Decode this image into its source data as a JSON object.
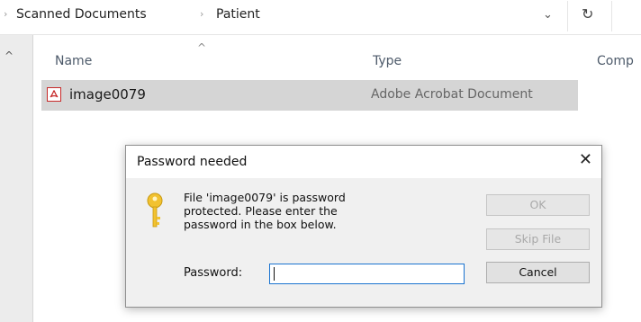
{
  "addressbar": {
    "breadcrumbs": [
      "Scanned Documents",
      "Patient"
    ],
    "separator": "›",
    "dropdown_icon": "chevron-down-icon",
    "refresh_icon": "refresh-icon"
  },
  "columns": {
    "name": "Name",
    "type": "Type",
    "compressed": "Comp"
  },
  "file_row": {
    "icon": "pdf-icon",
    "name": "image0079",
    "type": "Adobe Acrobat Document"
  },
  "dialog": {
    "title": "Password needed",
    "close_glyph": "✕",
    "message": "File 'image0079' is password protected. Please enter the password in the box below.",
    "ok_label": "OK",
    "skip_label": "Skip File",
    "cancel_label": "Cancel",
    "password_label": "Password:",
    "password_value": ""
  },
  "colors": {
    "selection": "#d5d5d5",
    "dialog_bg": "#f0f0f0",
    "input_focus_border": "#1a73d0",
    "key_icon": "#f2c230"
  }
}
